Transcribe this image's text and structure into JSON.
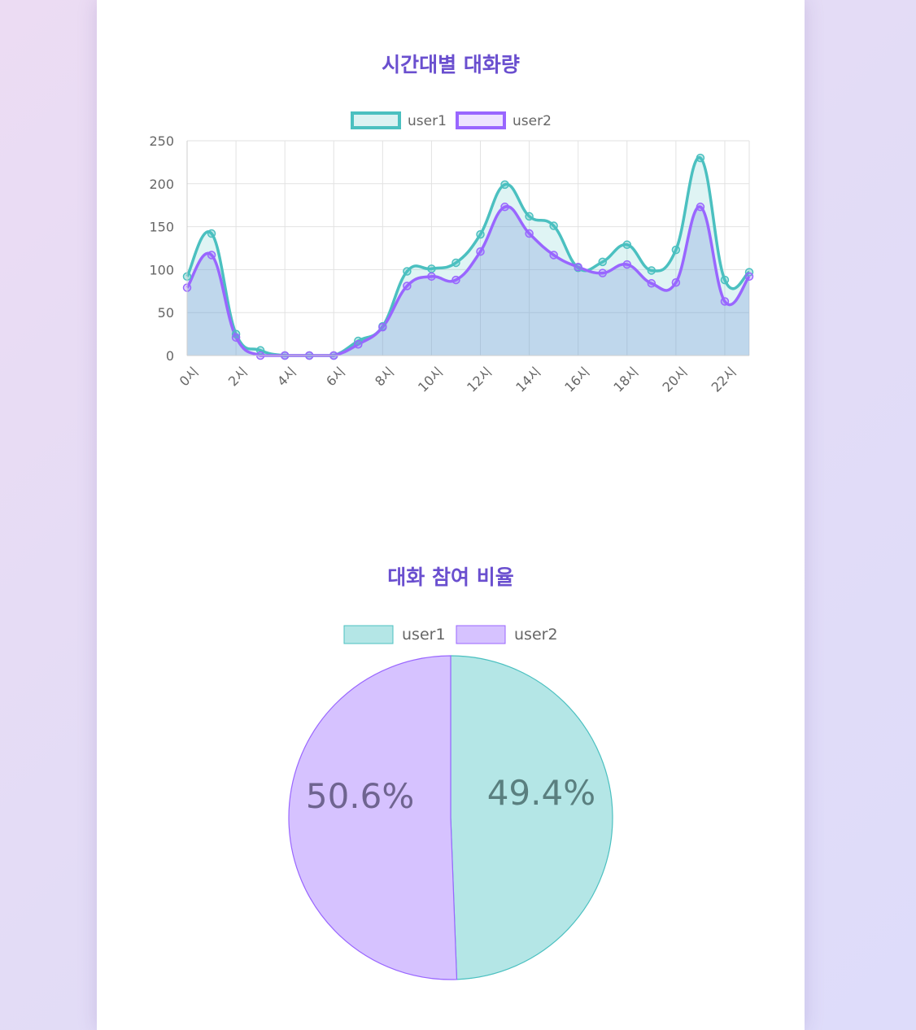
{
  "line_section": {
    "title": "시간대별 대화량"
  },
  "pie_section": {
    "title": "대화 참여 비율"
  },
  "colors": {
    "user1_line": "#4bc0c0",
    "user1_fill": "#b4e6e6",
    "user2_line": "#9966ff",
    "user2_fill": "#d6c2ff",
    "title": "#6a4fcf",
    "area_blend": "#c8d6f0",
    "grid": "#e2e2e2",
    "tick_text": "#666666"
  },
  "chart_data": [
    {
      "type": "line",
      "title": "시간대별 대화량",
      "categories": [
        "0시",
        "1시",
        "2시",
        "3시",
        "4시",
        "5시",
        "6시",
        "7시",
        "8시",
        "9시",
        "10시",
        "11시",
        "12시",
        "13시",
        "14시",
        "15시",
        "16시",
        "17시",
        "18시",
        "19시",
        "20시",
        "21시",
        "22시",
        "23시"
      ],
      "x_tick_labels": [
        "0시",
        "2시",
        "4시",
        "6시",
        "8시",
        "10시",
        "12시",
        "14시",
        "16시",
        "18시",
        "20시",
        "22시"
      ],
      "series": [
        {
          "name": "user1",
          "color": "#4bc0c0",
          "values": [
            92,
            142,
            25,
            6,
            0,
            0,
            0,
            17,
            34,
            98,
            101,
            108,
            141,
            199,
            162,
            151,
            102,
            109,
            129,
            99,
            123,
            230,
            88,
            97
          ]
        },
        {
          "name": "user2",
          "color": "#9966ff",
          "values": [
            79,
            117,
            21,
            0,
            0,
            0,
            0,
            13,
            33,
            81,
            92,
            88,
            121,
            173,
            142,
            117,
            103,
            96,
            106,
            84,
            85,
            173,
            63,
            92
          ]
        }
      ],
      "ylim": [
        0,
        250
      ],
      "y_ticks": [
        "0",
        "50",
        "100",
        "150",
        "200",
        "250"
      ],
      "grid": true,
      "legend": "top",
      "fill": true,
      "smooth": true
    },
    {
      "type": "pie",
      "title": "대화 참여 비율",
      "labels": [
        "user1",
        "user2"
      ],
      "values": [
        49.4,
        50.6
      ],
      "display_labels": [
        "49.4%",
        "50.6%"
      ],
      "colors": [
        "#b4e6e6",
        "#d6c2ff"
      ],
      "border_colors": [
        "#4bc0c0",
        "#9966ff"
      ],
      "legend": "top"
    }
  ]
}
